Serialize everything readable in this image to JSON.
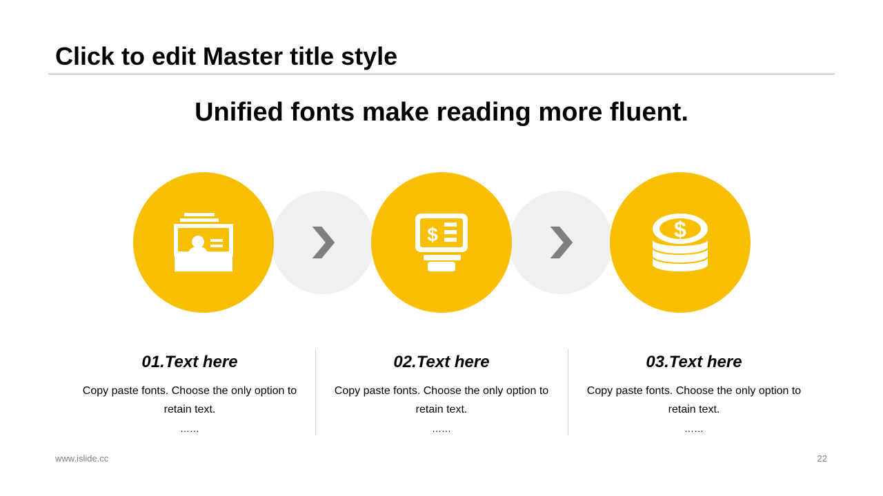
{
  "slide": {
    "master_title": "Click to edit Master title style",
    "subtitle": "Unified fonts make reading more fluent.",
    "accent_color": "#F8BE00",
    "arrow_circle_color": "#F0F0F0",
    "arrow_color": "#7F7F7F"
  },
  "steps": [
    {
      "icon": "card-file-icon",
      "title": "01.Text here",
      "body": "Copy paste fonts. Choose the only option to retain text.",
      "dots": "……"
    },
    {
      "icon": "atm-icon",
      "title": "02.Text here",
      "body": "Copy paste fonts. Choose the only option to retain text.",
      "dots": "……"
    },
    {
      "icon": "coin-stack-icon",
      "title": "03.Text here",
      "body": "Copy paste fonts. Choose the only option to retain text.",
      "dots": "……"
    }
  ],
  "footer": {
    "url": "www.islide.cc",
    "page_number": "22"
  }
}
